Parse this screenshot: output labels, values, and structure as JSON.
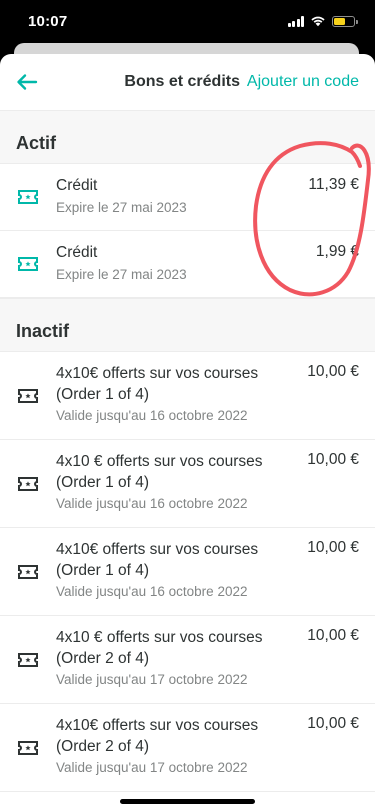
{
  "status_bar": {
    "time": "10:07",
    "battery_color": "#f7d21b"
  },
  "navbar": {
    "back_icon": "arrow-left-icon",
    "title": "Bons et crédits",
    "action": "Ajouter un code",
    "accent_color": "#00b8a9"
  },
  "sections": {
    "active": {
      "title": "Actif",
      "items": [
        {
          "title": "Crédit",
          "subtitle": "Expire le 27 mai 2023",
          "amount": "11,39 €"
        },
        {
          "title": "Crédit",
          "subtitle": "Expire le 27 mai 2023",
          "amount": "1,99 €"
        }
      ]
    },
    "inactive": {
      "title": "Inactif",
      "items": [
        {
          "title_line1": "4x10€ offerts sur vos courses",
          "title_line2": "(Order 1 of 4)",
          "subtitle": "Valide jusqu'au 16 octobre 2022",
          "amount": "10,00 €"
        },
        {
          "title_line1": "4x10 € offerts sur vos courses",
          "title_line2": "(Order 1 of 4)",
          "subtitle": "Valide jusqu'au 16 octobre 2022",
          "amount": "10,00 €"
        },
        {
          "title_line1": "4x10€ offerts sur vos courses",
          "title_line2": "(Order 1 of 4)",
          "subtitle": "Valide jusqu'au 16 octobre 2022",
          "amount": "10,00 €"
        },
        {
          "title_line1": "4x10 € offerts sur vos courses",
          "title_line2": "(Order 2 of 4)",
          "subtitle": "Valide jusqu'au 17 octobre 2022",
          "amount": "10,00 €"
        },
        {
          "title_line1": "4x10€ offerts sur vos courses",
          "title_line2": "(Order 2 of 4)",
          "subtitle": "Valide jusqu'au 17 octobre 2022",
          "amount": "10,00 €"
        }
      ]
    }
  },
  "icons": {
    "voucher_active": "ticket-icon-teal",
    "voucher_inactive": "ticket-icon-dark"
  },
  "annotation": {
    "shape": "hand-drawn-circle",
    "color": "#f0565f"
  }
}
